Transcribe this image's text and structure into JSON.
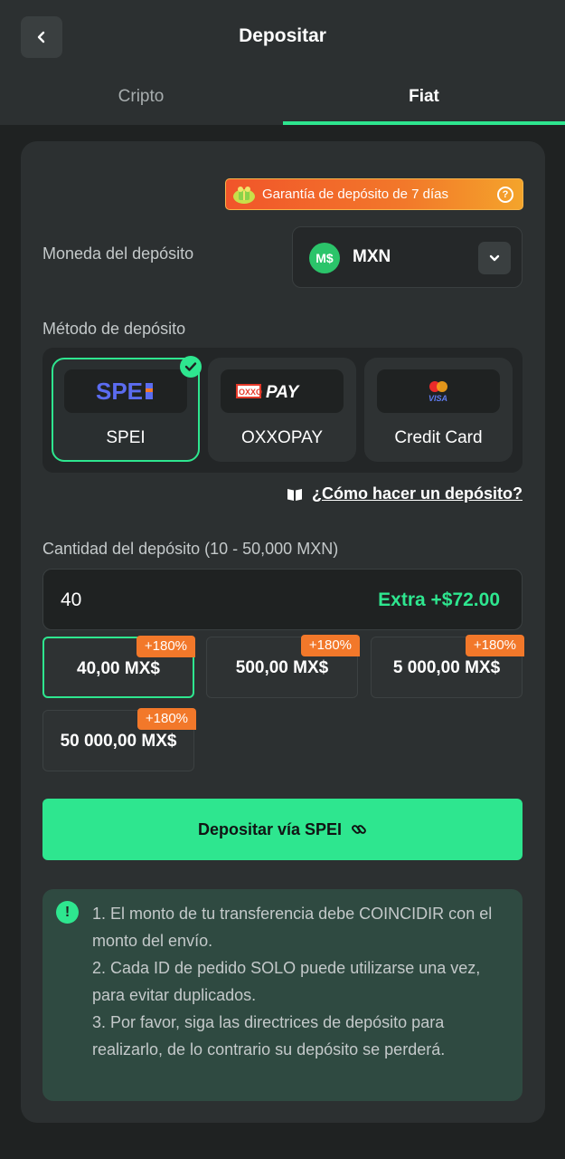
{
  "header": {
    "title": "Depositar",
    "back_icon": "chevron-left-icon",
    "tabs": [
      {
        "label": "Cripto",
        "active": false
      },
      {
        "label": "Fiat",
        "active": true
      }
    ],
    "accent": "#2ee68f"
  },
  "guarantee": {
    "label": "Garantía de depósito de 7 días",
    "help_glyph": "?"
  },
  "currency": {
    "label": "Moneda del depósito",
    "logo_text": "M$",
    "code": "MXN"
  },
  "methods": {
    "label": "Método de depósito",
    "items": [
      {
        "name": "SPEI",
        "logo": "SPEI",
        "selected": true
      },
      {
        "name": "OXXOPAY",
        "logo": "OXXO PAY",
        "selected": false
      },
      {
        "name": "Credit Card",
        "logo": "VISA",
        "selected": false
      }
    ]
  },
  "howto": {
    "label": "¿Cómo hacer un depósito?"
  },
  "amount": {
    "label": "Cantidad del depósito (10 - 50,000 MXN)",
    "value": "40",
    "extra": "Extra +$72.00"
  },
  "presets": [
    {
      "value": "40,00 MX$",
      "tag": "+180%",
      "selected": true
    },
    {
      "value": "500,00 MX$",
      "tag": "+180%",
      "selected": false
    },
    {
      "value": "5 000,00 MX$",
      "tag": "+180%",
      "selected": false
    },
    {
      "value": "50 000,00 MX$",
      "tag": "+180%",
      "selected": false
    }
  ],
  "cta": {
    "label": "Depositar vía SPEI"
  },
  "notice": {
    "lines": [
      "1. El monto de tu transferencia debe COINCIDIR con el monto del envío.",
      "2. Cada ID de pedido SOLO puede utilizarse una vez, para evitar duplicados.",
      "3. Por favor, siga las directrices de depósito para realizarlo, de lo contrario su depósito se perderá."
    ]
  }
}
